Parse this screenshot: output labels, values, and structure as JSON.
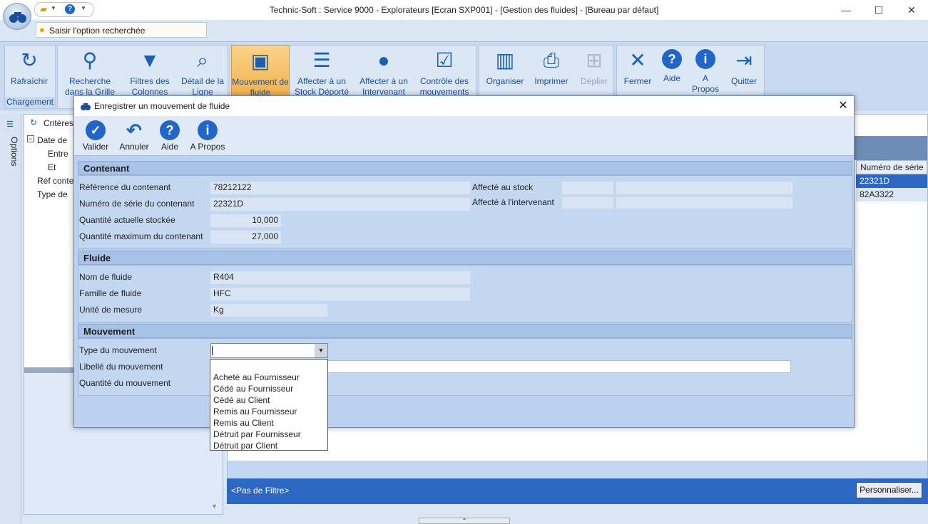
{
  "window": {
    "title": "Technic-Soft : Service 9000 - Explorateurs [Ecran SXP001] - [Gestion des fluides] - [Bureau par défaut]",
    "minimize": "—",
    "maximize": "☐",
    "close": "✕"
  },
  "search": {
    "placeholder": "Saisir l'option recherchée"
  },
  "ribbon": {
    "chargement_label": "Chargement",
    "buttons": [
      {
        "label": "Rafraîchir",
        "icon": "refresh-icon"
      },
      {
        "label": "Recherche dans la Grille",
        "icon": "binoculars-icon"
      },
      {
        "label": "Filtres des Colonnes",
        "icon": "filter-icon"
      },
      {
        "label": "Détail de la Ligne",
        "icon": "magnifier-icon"
      },
      {
        "label": "Mouvement de fluide",
        "icon": "cubes-icon"
      },
      {
        "label": "Affecter à un Stock Déporté",
        "icon": "database-icon"
      },
      {
        "label": "Affecter à un Intervenant",
        "icon": "person-icon"
      },
      {
        "label": "Contrôle des mouvements",
        "icon": "checkbox-icon"
      },
      {
        "label": "Organiser",
        "icon": "columns-icon"
      },
      {
        "label": "Imprimer",
        "icon": "printer-icon"
      },
      {
        "label": "Déplier",
        "icon": "tree-icon"
      },
      {
        "label": "Fermer",
        "icon": "x-icon"
      },
      {
        "label": "Aide",
        "icon": "help-icon"
      },
      {
        "label": "A Propos",
        "icon": "info-icon"
      },
      {
        "label": "Quitter",
        "icon": "exit-icon"
      }
    ]
  },
  "background": {
    "options_label": "Options",
    "criteria_label": "Critères",
    "criteria_rows": [
      "Date de",
      "Entre",
      "Et",
      "Réf conte",
      "Type de"
    ],
    "grid_header": "Numéro de série",
    "grid_rows": [
      "22321D",
      "82A3322"
    ],
    "filter_text": "<Pas de Filtre>",
    "personalize_label": "Personnaliser..."
  },
  "dialog": {
    "title": "Enregistrer un mouvement de fluide",
    "toolbar": [
      {
        "label": "Valider",
        "icon": "check-icon"
      },
      {
        "label": "Annuler",
        "icon": "undo-icon"
      },
      {
        "label": "Aide",
        "icon": "help-icon"
      },
      {
        "label": "A Propos",
        "icon": "info-icon"
      }
    ],
    "contenant": {
      "header": "Contenant",
      "ref_label": "Référence du contenant",
      "ref_value": "78212122",
      "serial_label": "Numéro de série du contenant",
      "serial_value": "22321D",
      "qty_label": "Quantité actuelle stockée",
      "qty_value": "10,000",
      "max_label": "Quantité maximum du contenant",
      "max_value": "27,000",
      "stock_label": "Affecté au stock",
      "stock_value": "",
      "stock_value2": "",
      "interv_label": "Affecté à l'intervenant",
      "interv_value": "",
      "interv_value2": ""
    },
    "fluide": {
      "header": "Fluide",
      "name_label": "Nom de fluide",
      "name_value": "R404",
      "family_label": "Famille de fluide",
      "family_value": "HFC",
      "unit_label": "Unité de mesure",
      "unit_value": "Kg"
    },
    "mouvement": {
      "header": "Mouvement",
      "type_label": "Type du mouvement",
      "type_value": "",
      "libelle_label": "Libellé du mouvement",
      "libelle_value": "",
      "qty_label": "Quantité du mouvement",
      "options": [
        "Acheté au Fournisseur",
        "Cédé au Fournisseur",
        "Cédé au Client",
        "Remis au Fournisseur",
        "Remis au Client",
        "Détruit par Fournisseur",
        "Détruit par Client"
      ]
    }
  }
}
